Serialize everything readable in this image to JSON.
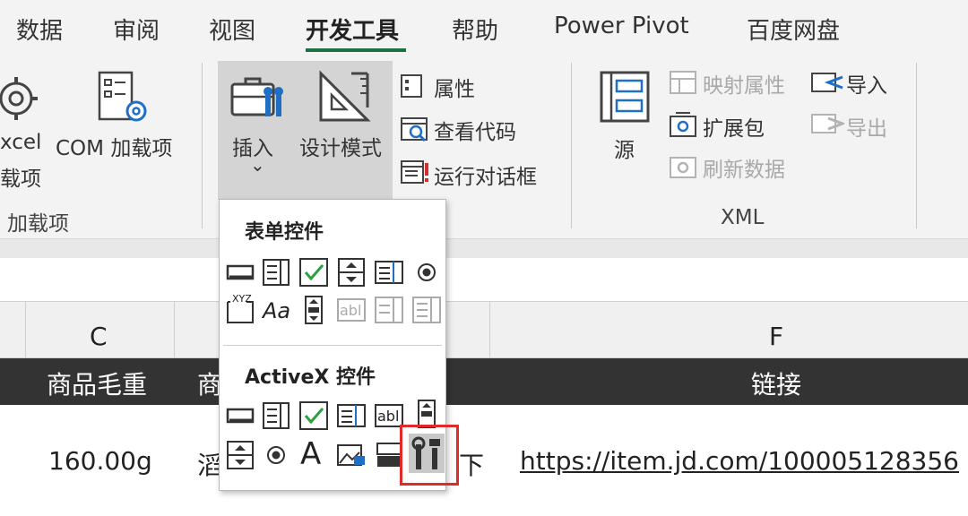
{
  "tabs": {
    "data": "数据",
    "review": "审阅",
    "view": "视图",
    "developer": "开发工具",
    "help": "帮助",
    "power_pivot": "Power Pivot",
    "baidu": "百度网盘"
  },
  "ribbon": {
    "excel_addins_l1": "xcel",
    "excel_addins_l2": "载项",
    "com_addins": "COM 加载项",
    "addins_group": "加载项",
    "insert": "插入",
    "insert_chevron": "⌄",
    "design_mode": "设计模式",
    "properties": "属性",
    "view_code": "查看代码",
    "run_dialog": "运行对话框",
    "source": "源",
    "map_properties": "映射属性",
    "expansion_pack": "扩展包",
    "refresh_data": "刷新数据",
    "import": "导入",
    "export": "导出",
    "xml_group": "XML"
  },
  "dropdown": {
    "form_controls_title": "表单控件",
    "activex_title": "ActiveX 控件",
    "xyz_label": "XYZ",
    "aa_label": "Aa",
    "abl_label": "abl",
    "a_label": "A"
  },
  "sheet": {
    "col_c": "C",
    "col_f": "F",
    "header_c": "商品毛重",
    "header_d_partial": "商",
    "header_f": "链接",
    "row_c": "160.00g",
    "row_d_partial": "滔",
    "row_e_partial": "下",
    "row_f": "https://item.jd.com/100005128356"
  },
  "colors": {
    "accent": "#1e7145",
    "highlight": "#e02b2b",
    "link": "#1565c0"
  }
}
